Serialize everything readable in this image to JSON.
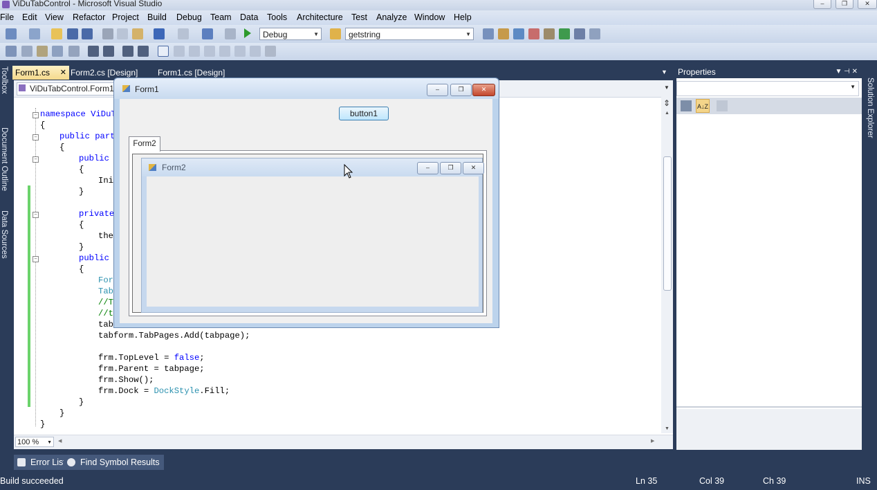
{
  "window": {
    "title": "ViDuTabControl - Microsoft Visual Studio",
    "min_glyph": "–",
    "max_glyph": "❐",
    "close_glyph": "✕"
  },
  "menu": [
    "File",
    "Edit",
    "View",
    "Refactor",
    "Project",
    "Build",
    "Debug",
    "Team",
    "Data",
    "Tools",
    "Architecture",
    "Test",
    "Analyze",
    "Window",
    "Help"
  ],
  "toolbar": {
    "config": "Debug",
    "find": "getstring",
    "combo_arrow": "▼"
  },
  "left_strip": {
    "toolbox": "Toolbox",
    "document_outline": "Document Outline",
    "data_sources": "Data Sources"
  },
  "doc_tabs": {
    "tab1": "Form1.cs",
    "tab1_close": "✕",
    "tab2": "Form2.cs [Design]",
    "tab3": "Form1.cs [Design]",
    "dropdown": "▼"
  },
  "editor": {
    "nav_left": "ViDuTabControl.Form1",
    "nav_arrow": "▼",
    "zoom": "100 %",
    "code": {
      "l1": "namespace ViDuT",
      "l2": "{",
      "l3": "public parti",
      "l4": "{",
      "l5": "public F",
      "l6": "{",
      "l7": "Init",
      "l8": "}",
      "l9": "private",
      "l10": "{",
      "l11": "then",
      "l12": "}",
      "l13": "public v",
      "l14": "{",
      "l15": "Form",
      "l16": "Tabl",
      "l17": "//Ta",
      "l18": "//ta",
      "l19": "tab",
      "l20": "tabform.TabPages.Add(tabpage);",
      "l21a": "frm.TopLevel = ",
      "l21b": "false",
      "l21c": ";",
      "l22": "frm.Parent = tabpage;",
      "l23": "frm.Show();",
      "l24a": "frm.Dock = ",
      "l24b": "DockStyle",
      "l24c": ".Fill;",
      "l25": "}",
      "l26": "}",
      "l27": "}"
    },
    "fold_glyph": "–",
    "scroll_up": "▲",
    "scroll_down": "▼",
    "scroll_left": "◀",
    "scroll_right": "▶",
    "splitter": "⇕"
  },
  "form1": {
    "title": "Form1",
    "button1": "button1",
    "tab_label": "Form2",
    "min_glyph": "–",
    "max_glyph": "❐",
    "close_glyph": "✕",
    "inner_form": {
      "title": "Form2",
      "min_glyph": "–",
      "max_glyph": "❐",
      "close_glyph": "✕"
    }
  },
  "properties": {
    "title": "Properties",
    "pin": "▼ ⊣ ✕",
    "combo_arrow": "▼",
    "sort_az": "A↓Z"
  },
  "solution_explorer_strip": "Solution Explorer",
  "bottom_tabs": {
    "error_list": "Error List",
    "find_symbol": "Find Symbol Results"
  },
  "status": {
    "message": "Build succeeded",
    "ln": "Ln 35",
    "col": "Col 39",
    "ch": "Ch 39",
    "mode": "INS"
  },
  "colors": {
    "chrome": "#2b3c59",
    "active_tab": "#f5d98c",
    "keyword": "#0000ff",
    "type": "#2b91af",
    "comment": "#008000",
    "changed_bar": "#6bd36b"
  }
}
